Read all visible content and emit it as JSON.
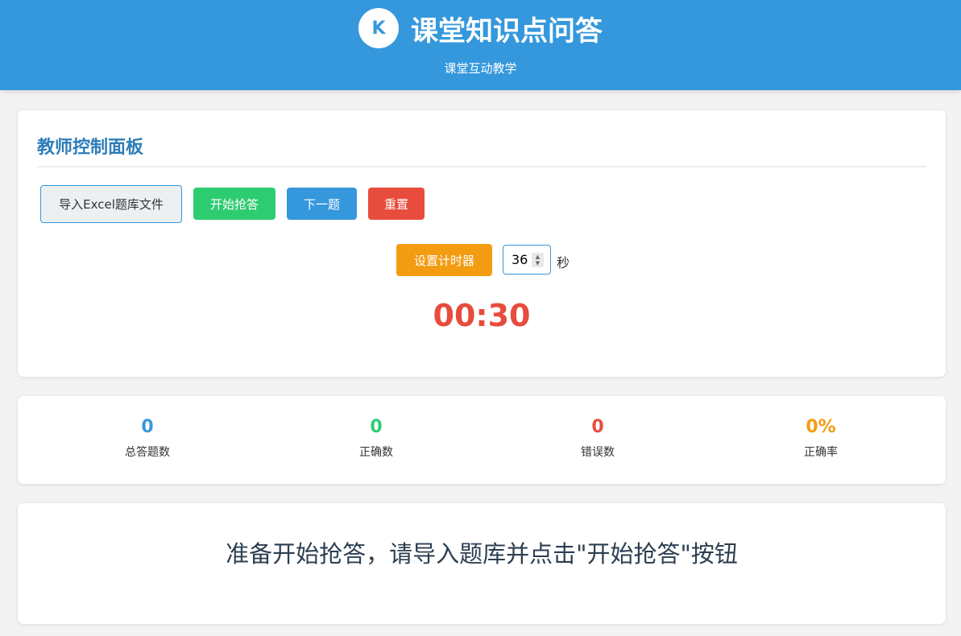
{
  "header": {
    "logo_letter": "K",
    "title": "课堂知识点问答",
    "subtitle": "课堂互动教学",
    "bg_color": "#3598dc"
  },
  "control_panel": {
    "title": "教师控制面板",
    "buttons": {
      "import_label": "导入Excel题库文件",
      "start_label": "开始抢答",
      "next_label": "下一题",
      "reset_label": "重置",
      "set_timer_label": "设置计时器"
    },
    "timer_input_value": "36",
    "seconds_label": "秒",
    "countdown": "00:30",
    "colors": {
      "start": "#2ecc71",
      "next": "#3598dc",
      "reset": "#e74c3c",
      "timer": "#f39c12"
    }
  },
  "stats": [
    {
      "value": "0",
      "label": "总答题数",
      "color": "#3598dc"
    },
    {
      "value": "0",
      "label": "正确数",
      "color": "#2ecc71"
    },
    {
      "value": "0",
      "label": "错误数",
      "color": "#e74c3c"
    },
    {
      "value": "0%",
      "label": "正确率",
      "color": "#f39c12"
    }
  ],
  "question_area": {
    "message": "准备开始抢答，请导入题库并点击\"开始抢答\"按钮"
  }
}
